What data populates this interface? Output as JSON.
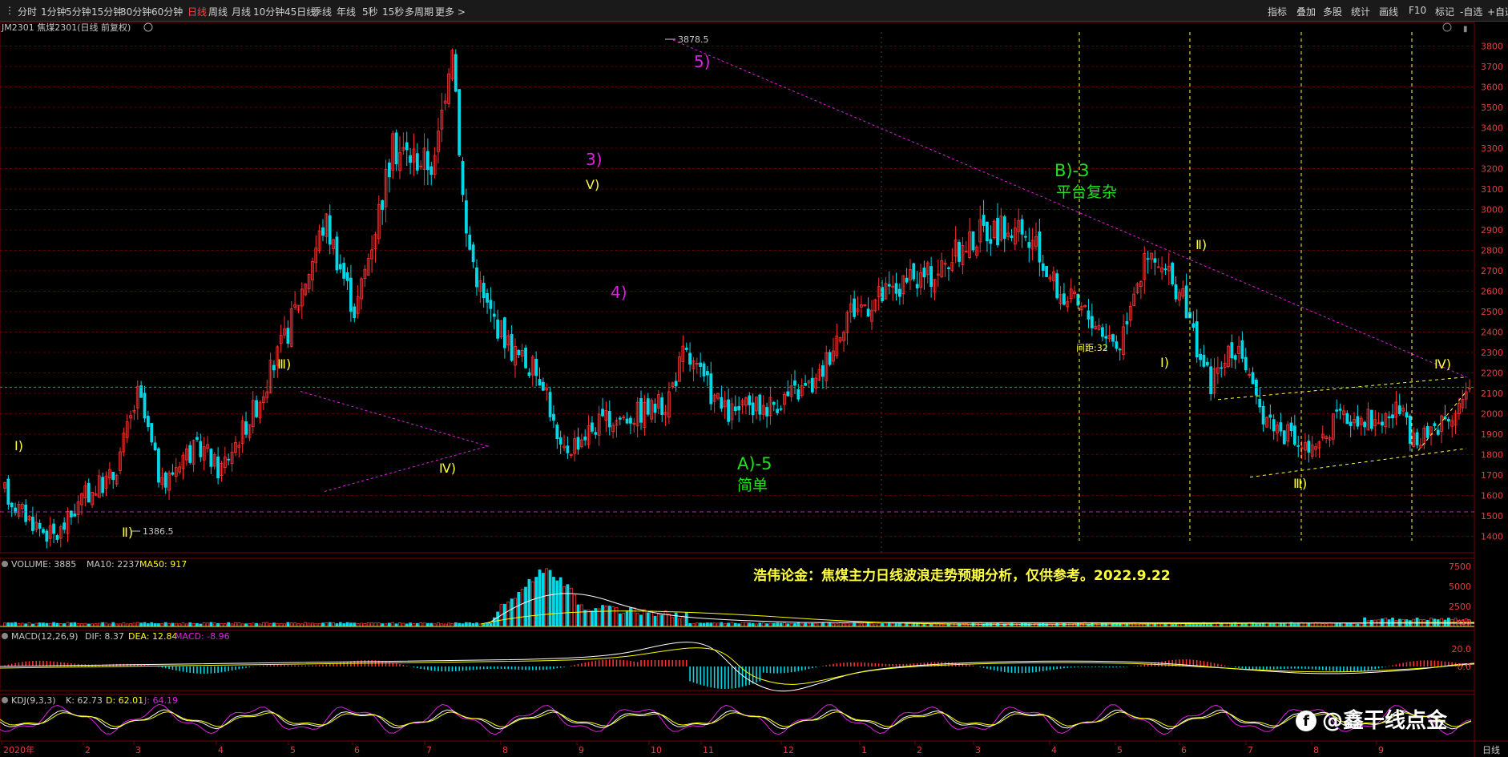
{
  "toolbar": {
    "left": [
      "分时",
      "1分钟",
      "5分钟",
      "15分钟",
      "30分钟",
      "60分钟",
      "日线",
      "周线",
      "月线",
      "10分钟",
      "45日线",
      "季线",
      "年线",
      "5秒",
      "15秒",
      "多周期",
      "更多 >"
    ],
    "active": "日线",
    "right": [
      "指标",
      "叠加",
      "多股",
      "统计",
      "画线",
      "F10",
      "标记",
      "-自选",
      "+自选"
    ]
  },
  "symbol_info": "JM2301 焦煤2301(日线 前复权)",
  "price_panel": {
    "high_label": "3878.5",
    "low_label": "1386.5",
    "gap_label": "间距:32",
    "y_ticks": [
      "3800",
      "3700",
      "3600",
      "3500",
      "3400",
      "3300",
      "3200",
      "3100",
      "3000",
      "2900",
      "2800",
      "2700",
      "2600",
      "2500",
      "2400",
      "2300",
      "2200",
      "2100",
      "2000",
      "1900",
      "1800",
      "1700",
      "1600",
      "1500",
      "1400"
    ]
  },
  "wave_labels": {
    "w_i_a": "Ⅰ)",
    "w_ii_a": "Ⅱ)",
    "w_iii_a": "Ⅲ)",
    "w_iv_a": "Ⅳ)",
    "w_v_a": "Ⅴ)",
    "w3": "3)",
    "w4": "4)",
    "w5": "5)",
    "a5": "A)-5",
    "a5_sub": "简单",
    "b3": "B)-3",
    "b3_sub": "平台复杂",
    "w_i_b": "Ⅰ)",
    "w_ii_b": "Ⅱ)",
    "w_iii_b": "Ⅲ)",
    "w_iv_b": "Ⅳ)"
  },
  "volume_panel": {
    "name": "VOLUME",
    "value": "3885",
    "ma10": "MA10: 2237",
    "ma50": "MA50: 917",
    "y_ticks": [
      "7500",
      "5000",
      "2500"
    ],
    "unit": "X10"
  },
  "title_text": "浩伟论金：焦煤主力日线波浪走势预期分析，仅供参考。2022.9.22",
  "macd_panel": {
    "name": "MACD(12,26,9)",
    "dif": "DIF: 8.37",
    "dea": "DEA: 12.84",
    "macd": "MACD: -8.96",
    "y_ticks": [
      "20.0",
      "0.0"
    ]
  },
  "kdj_panel": {
    "name": "KDJ(9,3,3)",
    "k": "K: 62.73",
    "d": "D: 62.01",
    "j": "J: 64.19"
  },
  "x_axis": {
    "labels": [
      "2020年",
      "2",
      "3",
      "4",
      "5",
      "6",
      "7",
      "8",
      "9",
      "10",
      "11",
      "12",
      "1",
      "2",
      "3",
      "4",
      "5",
      "6",
      "7",
      "8",
      "9"
    ],
    "period": "日线"
  },
  "watermark": "@鑫干线点金",
  "colors": {
    "up": "#ff3030",
    "down": "#00d8e8",
    "ma": "#ffff00",
    "wave_magenta": "#e020e0",
    "wave_yellow": "#ffff40",
    "wave_green": "#20e020",
    "grid": "#5a0000",
    "h_green": "#00c000"
  }
}
